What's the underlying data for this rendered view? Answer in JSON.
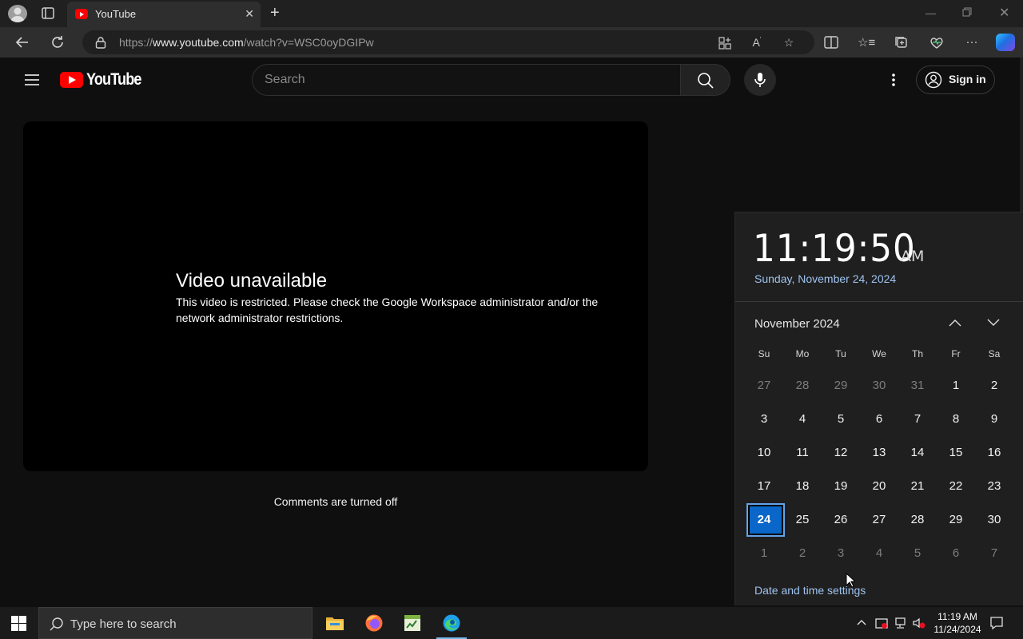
{
  "browser": {
    "tab_title": "YouTube",
    "url_prefix": "https://",
    "url_host": "www.youtube.com",
    "url_path": "/watch?v=WSC0oyDGIPw"
  },
  "youtube": {
    "logo_text": "YouTube",
    "search_placeholder": "Search",
    "sign_in": "Sign in",
    "error_title": "Video unavailable",
    "error_body": "This video is restricted. Please check the Google Workspace administrator and/or the network administrator restrictions.",
    "comments_status": "Comments are turned off"
  },
  "calendar": {
    "time": "11:19:50",
    "ampm": "AM",
    "long_date": "Sunday, November 24, 2024",
    "month_label": "November 2024",
    "weekdays": [
      "Su",
      "Mo",
      "Tu",
      "We",
      "Th",
      "Fr",
      "Sa"
    ],
    "days": [
      {
        "d": "27",
        "muted": true
      },
      {
        "d": "28",
        "muted": true
      },
      {
        "d": "29",
        "muted": true
      },
      {
        "d": "30",
        "muted": true
      },
      {
        "d": "31",
        "muted": true
      },
      {
        "d": "1"
      },
      {
        "d": "2"
      },
      {
        "d": "3"
      },
      {
        "d": "4"
      },
      {
        "d": "5"
      },
      {
        "d": "6"
      },
      {
        "d": "7"
      },
      {
        "d": "8"
      },
      {
        "d": "9"
      },
      {
        "d": "10"
      },
      {
        "d": "11"
      },
      {
        "d": "12"
      },
      {
        "d": "13"
      },
      {
        "d": "14"
      },
      {
        "d": "15"
      },
      {
        "d": "16"
      },
      {
        "d": "17"
      },
      {
        "d": "18"
      },
      {
        "d": "19"
      },
      {
        "d": "20"
      },
      {
        "d": "21"
      },
      {
        "d": "22"
      },
      {
        "d": "23"
      },
      {
        "d": "24",
        "today": true
      },
      {
        "d": "25"
      },
      {
        "d": "26"
      },
      {
        "d": "27"
      },
      {
        "d": "28"
      },
      {
        "d": "29"
      },
      {
        "d": "30"
      },
      {
        "d": "1",
        "muted": true
      },
      {
        "d": "2",
        "muted": true
      },
      {
        "d": "3",
        "muted": true
      },
      {
        "d": "4",
        "muted": true
      },
      {
        "d": "5",
        "muted": true
      },
      {
        "d": "6",
        "muted": true
      },
      {
        "d": "7",
        "muted": true
      }
    ],
    "settings_link": "Date and time settings"
  },
  "taskbar": {
    "search_placeholder": "Type here to search",
    "time": "11:19 AM",
    "date": "11/24/2024"
  },
  "colors": {
    "youtube_red": "#ff0000",
    "accent_blue": "#0a66c8",
    "link_blue": "#9fc3f0"
  }
}
